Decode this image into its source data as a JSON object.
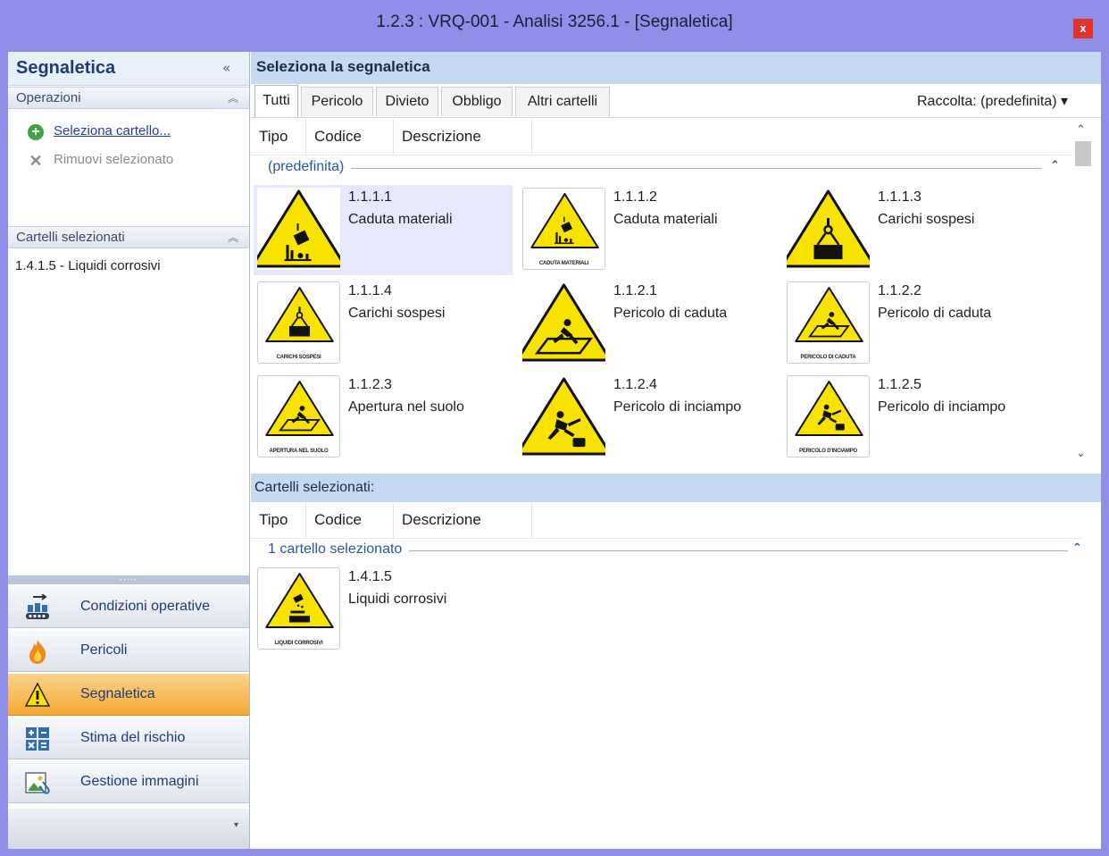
{
  "window": {
    "title": "1.2.3 : VRQ-001 - Analisi 3256.1 - [Segnaletica]",
    "close_label": "x"
  },
  "left_panel": {
    "title": "Segnaletica",
    "collapse_glyph": "«",
    "operations": {
      "header": "Operazioni",
      "items": [
        {
          "label": "Seleziona cartello...",
          "icon": "add-icon",
          "enabled": true
        },
        {
          "label": "Rimuovi selezionato",
          "icon": "remove-icon",
          "enabled": false
        }
      ]
    },
    "selected_signs": {
      "header": "Cartelli selezionati",
      "items": [
        "1.4.1.5 - Liquidi corrosivi"
      ]
    },
    "splitter_grip": ".....",
    "nav": [
      {
        "label": "Condizioni operative",
        "icon": "operating-conditions-icon",
        "active": false
      },
      {
        "label": "Pericoli",
        "icon": "fire-icon",
        "active": false
      },
      {
        "label": "Segnaletica",
        "icon": "warning-sign-icon",
        "active": true
      },
      {
        "label": "Stima del rischio",
        "icon": "calculator-icon",
        "active": false
      },
      {
        "label": "Gestione immagini",
        "icon": "image-attachment-icon",
        "active": false
      }
    ],
    "footer_chevron": "▾"
  },
  "main": {
    "header": "Seleziona la segnaletica",
    "tabs": [
      "Tutti",
      "Pericolo",
      "Divieto",
      "Obbligo",
      "Altri cartelli"
    ],
    "active_tab": "Tutti",
    "collection": {
      "label": "Raccolta: (predefinita)",
      "dropdown_glyph": "▾"
    },
    "columns": [
      "Tipo",
      "Codice",
      "Descrizione"
    ],
    "group": {
      "label": "(predefinita)",
      "collapse_glyph": "⌃"
    },
    "items": [
      {
        "code": "1.1.1.1",
        "description": "Caduta materiali",
        "caption": "",
        "symbol": "falling-objects",
        "selected": true
      },
      {
        "code": "1.1.1.2",
        "description": "Caduta materiali",
        "caption": "CADUTA MATERIALI",
        "symbol": "falling-objects",
        "selected": false
      },
      {
        "code": "1.1.1.3",
        "description": "Carichi sospesi",
        "caption": "",
        "symbol": "suspended-load",
        "selected": false
      },
      {
        "code": "1.1.1.4",
        "description": "Carichi sospesi",
        "caption": "CARICHI SOSPESI",
        "symbol": "suspended-load",
        "selected": false
      },
      {
        "code": "1.1.2.1",
        "description": "Pericolo di caduta",
        "caption": "",
        "symbol": "fall-hazard",
        "selected": false
      },
      {
        "code": "1.1.2.2",
        "description": "Pericolo di caduta",
        "caption": "PERICOLO DI CADUTA",
        "symbol": "fall-hazard",
        "selected": false
      },
      {
        "code": "1.1.2.3",
        "description": "Apertura nel suolo",
        "caption": "APERTURA NEL SUOLO",
        "symbol": "fall-hazard",
        "selected": false
      },
      {
        "code": "1.1.2.4",
        "description": "Pericolo di inciampo",
        "caption": "",
        "symbol": "trip-hazard",
        "selected": false
      },
      {
        "code": "1.1.2.5",
        "description": "Pericolo di inciampo",
        "caption": "PERICOLO D'INCIAMPO",
        "symbol": "trip-hazard",
        "selected": false
      }
    ],
    "scroll": {
      "up": "⌃",
      "down": "⌄"
    },
    "selected_section": {
      "header": "Cartelli selezionati:",
      "columns": [
        "Tipo",
        "Codice",
        "Descrizione"
      ],
      "group": {
        "label": "1 cartello selezionato",
        "collapse_glyph": "⌃"
      },
      "items": [
        {
          "code": "1.4.1.5",
          "description": "Liquidi corrosivi",
          "caption": "LIQUIDI CORROSIVI",
          "symbol": "corrosive"
        }
      ]
    }
  },
  "colors": {
    "title_bar": "#8f8fe8",
    "panel_header": "#c5daf0",
    "warning_yellow": "#f7e200",
    "active_nav": "#f6a830",
    "link": "#1e3fa8"
  }
}
